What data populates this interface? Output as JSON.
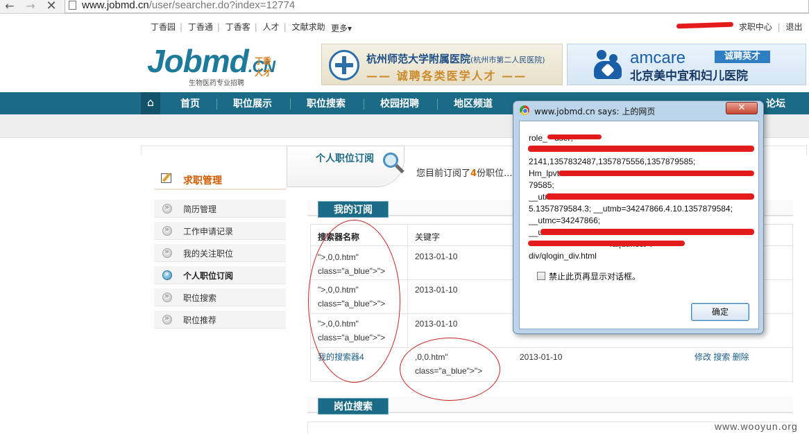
{
  "browser": {
    "url_host": "www.jobmd.cn",
    "url_path": "/user/searcher.do?index=12774"
  },
  "toplinks": [
    "丁香园",
    "丁香通",
    "丁香客",
    "人才",
    "文献求助"
  ],
  "more_label": "更多▾",
  "user_links": {
    "job_center": "求职中心",
    "logout": "退出"
  },
  "logo": {
    "main": "Jobmd",
    "cn": ".CN",
    "tag": "丁香人才",
    "sub": "生物医药专业招聘"
  },
  "ads": {
    "ad1_title": "杭州师范大学附属医院",
    "ad1_title_small": "(杭州市第二人民医院)",
    "ad1_slogan": "—— 诚聘各类医学人才 ——",
    "ad2_brand": "amcare",
    "ad2_badge": "诚聘英才",
    "ad2_hospital": "北京美中宜和妇儿医院"
  },
  "nav": {
    "home_icon": "⌂",
    "items": [
      "首页",
      "职位展示",
      "职位搜索",
      "校园招聘",
      "地区频道",
      "论坛"
    ]
  },
  "content": {
    "tab_title": "个人职位订阅",
    "notice_before": "您目前订阅了",
    "notice_count": "4",
    "notice_after": "份职位..."
  },
  "sidebar": {
    "title": "求职管理",
    "items": [
      {
        "label": "简历管理"
      },
      {
        "label": "工作申请记录"
      },
      {
        "label": "我的关注职位"
      },
      {
        "label": "个人职位订阅"
      },
      {
        "label": "职位搜索"
      },
      {
        "label": "职位推荐"
      }
    ]
  },
  "section1_title": "我的订阅",
  "section2_title": "岗位搜索",
  "table": {
    "headers": [
      "搜索器名称",
      "关键字"
    ],
    "rows": [
      {
        "name_l1": "\">,0,0.htm\"",
        "name_l2": "class=\"a_blue\">\">",
        "keyword": "2013-01-10",
        "keyword_l2": "",
        "date": "",
        "actions": ""
      },
      {
        "name_l1": "\">,0,0.htm\"",
        "name_l2": "class=\"a_blue\">\">",
        "keyword": "2013-01-10",
        "keyword_l2": "",
        "date": "",
        "actions": ""
      },
      {
        "name_l1": "\">,0,0.htm\"",
        "name_l2": "class=\"a_blue\">\">",
        "keyword": "2013-01-10",
        "keyword_l2": "",
        "date": "",
        "actions": ""
      },
      {
        "name_l1": "我的搜索器4",
        "name_l2": "",
        "keyword": ",0,0.htm\"",
        "keyword_l2": "class=\"a_blue\">\">",
        "date": "2013-01-10",
        "actions": "修改 搜索 删除"
      }
    ]
  },
  "dialog": {
    "title": "www.jobmd.cn says: 上的网页",
    "close": "✕",
    "lines": [
      "role_            =user;",
      "",
      "2141,1357832487,1357875556,1357879585;",
      "Hm_lpvt",
      "79585;",
      "__utm",
      "5.1357879584.3; __utmb=34247866.4.10.1357879584;",
      "__utmc=34247866;",
      "__ut",
      "                                   ral|utmcct=/",
      "div/qlogin_div.html"
    ],
    "checkbox_label": "禁止此页再显示对话框。",
    "ok_label": "确定"
  },
  "watermark": "www.wooyun.org"
}
